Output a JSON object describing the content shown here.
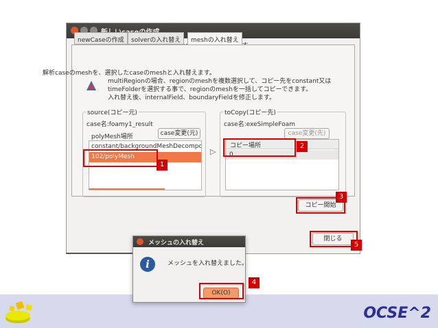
{
  "window": {
    "title": "新しいcaseの作成",
    "header": "caseを作成、変更します"
  },
  "tabs": [
    {
      "label": "newCaseの作成"
    },
    {
      "label": "solverの入れ替え"
    },
    {
      "label": "meshの入れ替え",
      "active": true
    }
  ],
  "description": {
    "lines": [
      "解析caseのmeshを、選択したcaseのmeshと入れ替えます。",
      "multiRegionの場合、regionのmeshを複数選択して、コピー先をconstant又は",
      "timeFolderを選択する事で、regionのmeshを一括してコピーできます。",
      "入れ替え後、internalField、boundaryFieldを修正します。"
    ]
  },
  "source": {
    "group_label": "source(コピー元)",
    "case_name": "case名:foamy1_result",
    "location_label": "polyMesh場所",
    "change_button": "case変更(元)",
    "items": [
      {
        "label": "constant/backgroundMeshDecompo",
        "selected": false
      },
      {
        "label": "102/polyMesh",
        "selected": true
      }
    ]
  },
  "arrow_glyph": "▷",
  "target": {
    "group_label": "toCopy(コピー先)",
    "case_name": "case名:exeSimpleFoam",
    "change_button": "case変更(先)",
    "column_header": "コピー場所",
    "items": [
      {
        "label": "0"
      }
    ]
  },
  "buttons": {
    "copy_start": "コピー開始",
    "close": "閉じる"
  },
  "dialog": {
    "title": "メッシュの入れ替え",
    "message": "メッシュを入れ替えました。",
    "ok": "OK(O)",
    "icon_glyph": "i"
  },
  "annotations": [
    "1",
    "2",
    "3",
    "4",
    "5"
  ],
  "logo": "OCSE^2",
  "colors": {
    "annotation_red": "#e00000",
    "selection_orange": "#f07746",
    "titlebar": "#3c3b37",
    "close_button": "#e0532b",
    "info_blue": "#2c5aa0",
    "logo_blue": "#2a2f9a",
    "footer_band": "#d7d9ec"
  }
}
